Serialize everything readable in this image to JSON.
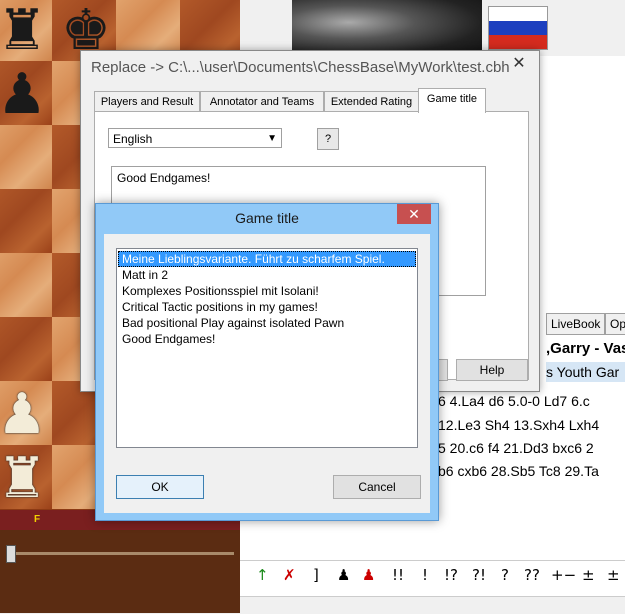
{
  "board": {
    "pieces": [
      {
        "glyph": "♜",
        "color": "b",
        "name": "black-rook-icon",
        "col": 0,
        "row": 0
      },
      {
        "glyph": "♚",
        "color": "b",
        "name": "black-king-icon",
        "col": 1,
        "row": 0
      },
      {
        "glyph": "♟",
        "color": "b",
        "name": "black-pawn-icon",
        "col": 0,
        "row": 1
      },
      {
        "glyph": "♟",
        "color": "w",
        "name": "white-pawn-icon",
        "col": 0,
        "row": 6
      },
      {
        "glyph": "♜",
        "color": "w",
        "name": "white-rook-icon",
        "col": 0,
        "row": 7
      }
    ],
    "file_label": "F"
  },
  "flag": {
    "colors": [
      "#ffffff",
      "#1c3fbf",
      "#d52b1e"
    ]
  },
  "replace_dialog": {
    "title": "Replace -> C:\\...\\user\\Documents\\ChessBase\\MyWork\\test.cbh",
    "close_glyph": "✕",
    "tabs": [
      "Players and Result",
      "Annotator and Teams",
      "Extended Rating",
      "Game title"
    ],
    "active_tab": "Game title",
    "language": "English",
    "question_button": "?",
    "title_text": "Good Endgames!",
    "help_button": "Help"
  },
  "game_title_dialog": {
    "title": "Game title",
    "close_glyph": "✕",
    "items": [
      "Meine Lieblingsvariante. Führt zu scharfem Spiel.",
      "Matt in 2",
      "Komplexes Positionsspiel mit Isolani!",
      "Critical Tactic positions in my games!",
      "Bad positional Play against isolated Pawn",
      "Good Endgames!"
    ],
    "selected_index": 0,
    "ok_label": "OK",
    "cancel_label": "Cancel"
  },
  "right_panel": {
    "tabs": [
      "LiveBook",
      "Op"
    ],
    "game_header": ",Garry - Vas",
    "game_sub": "s Youth Gar",
    "notation_lines": [
      "6  4.La4  d6  5.0-0  Ld7  6.c",
      "12.Le3  Sh4  13.Sxh4  Lxh4",
      "5  20.c6  f4  21.Dd3  bxc6  2",
      "b6  cxb6  28.Sb5  Tc8  29.Ta"
    ],
    "annotation_symbols": [
      "!!",
      "!",
      "!?",
      "?!",
      "?",
      "??",
      "+−",
      "±",
      "±"
    ]
  }
}
